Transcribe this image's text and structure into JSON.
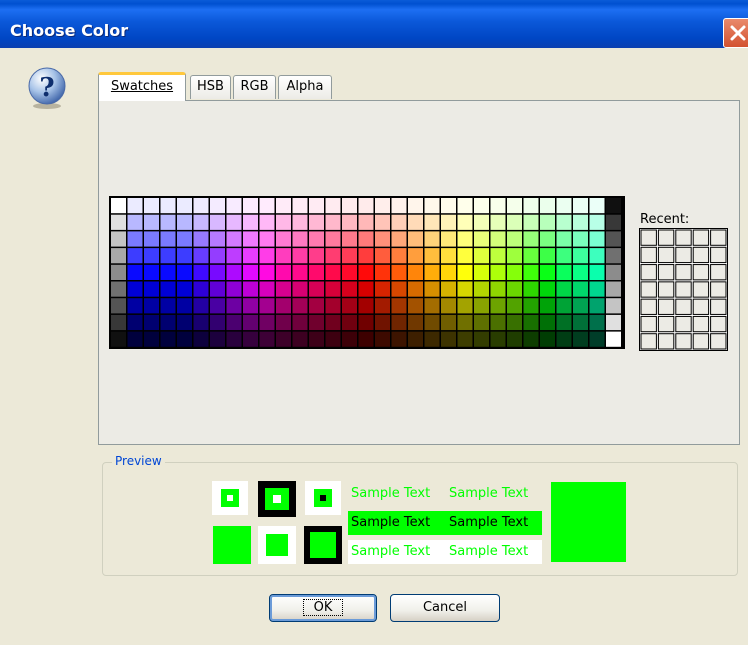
{
  "window": {
    "title": "Choose Color"
  },
  "tabs": [
    {
      "label": "Swatches",
      "selected": true
    },
    {
      "label": "HSB",
      "selected": false
    },
    {
      "label": "RGB",
      "selected": false
    },
    {
      "label": "Alpha",
      "selected": false
    }
  ],
  "swatches": {
    "recent_label": "Recent:",
    "recent_rows": 7,
    "recent_cols": 5
  },
  "preview": {
    "title": "Preview",
    "sample_text": "Sample Text",
    "selected_color": "#00ff00"
  },
  "buttons": {
    "ok": "OK",
    "cancel": "Cancel"
  },
  "icons": {
    "help": "help-question-icon",
    "close": "close-x-icon"
  }
}
